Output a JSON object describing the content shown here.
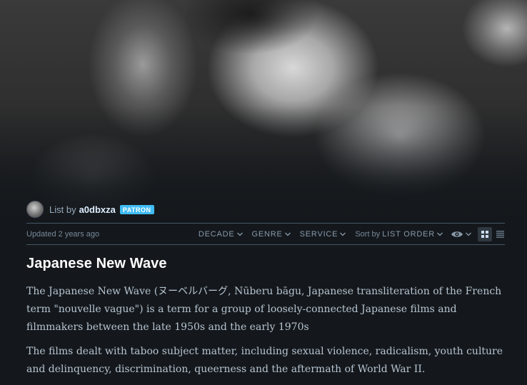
{
  "owner": {
    "prefix": "List by",
    "username": "a0dbxza",
    "badge": "PATRON"
  },
  "meta": {
    "updated": "Updated 2 years ago"
  },
  "filters": {
    "decade": "DECADE",
    "genre": "GENRE",
    "service": "SERVICE",
    "sort_prefix": "Sort by",
    "sort_value": "LIST ORDER"
  },
  "list": {
    "title": "Japanese New Wave",
    "description": [
      "The Japanese New Wave (ヌーベルバーグ, Nūberu bāgu, Japanese transliteration of the French term \"nouvelle vague\") is a term for a group of loosely-connected Japanese films and filmmakers between the late 1950s and the early 1970s",
      "The films dealt with taboo subject matter, including sexual violence, radicalism, youth culture and delinquency, discrimination, queerness and the aftermath of World War II."
    ]
  },
  "icons": {
    "visibility": "eye-icon",
    "grid_view": "grid-view-icon",
    "list_view": "list-view-icon"
  },
  "colors": {
    "background": "#14181c",
    "badge": "#40bcf4",
    "title": "#ffffff",
    "body_text": "#b7c4d0"
  }
}
